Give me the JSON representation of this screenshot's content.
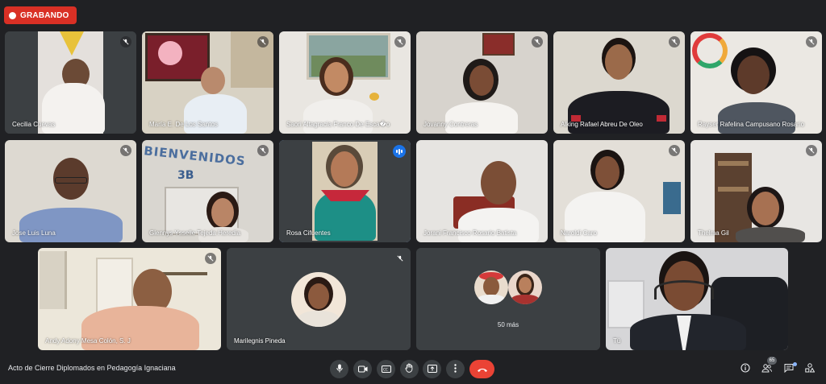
{
  "recording": {
    "label": "GRABANDO"
  },
  "participants": [
    {
      "name": "Cecilia Cuevas",
      "muted": true
    },
    {
      "name": "María E. De Los Santos",
      "muted": true
    },
    {
      "name": "Saori Altagracia Franco De Esca�o",
      "muted": true
    },
    {
      "name": "Jovanny Contreras",
      "muted": true
    },
    {
      "name": "Alking Rafael Abreu De Oleo",
      "muted": true
    },
    {
      "name": "Rayser Rafelina Campusano Rosario",
      "muted": true
    },
    {
      "name": "Jose Luis Luna",
      "muted": true
    },
    {
      "name": "Glennys Ysselle Tejeda Heredia",
      "muted": true
    },
    {
      "name": "Rosa Cifuentes",
      "muted": false,
      "speaking": true
    },
    {
      "name": "Jorani Francisco Rosario Batista",
      "muted": false
    },
    {
      "name": "Naroldi Caro",
      "muted": true
    },
    {
      "name": "Thelma Gil",
      "muted": true
    },
    {
      "name": "Andy Adony Mesa Colón, S. J",
      "muted": true
    },
    {
      "name": "Marilegnis Pineda",
      "muted": true
    },
    {
      "name": "Tú",
      "muted": false
    }
  ],
  "wallsign": {
    "line1": "BIENVENIDOS",
    "line2": "3B"
  },
  "overflow": {
    "label": "50 más"
  },
  "meeting": {
    "title": "Acto de Cierre Diplomados en Pedagogía Ignaciana"
  },
  "controls": [
    "microphone-icon",
    "camera-icon",
    "captions-icon",
    "raise-hand-icon",
    "present-icon",
    "more-options-icon",
    "end-call-icon"
  ],
  "right_controls": {
    "info": "info-icon",
    "people": "people-icon",
    "people_count": "65",
    "chat": "chat-icon",
    "activities": "activities-icon"
  },
  "colors": {
    "background": "#202124",
    "tile": "#3c4043",
    "recording": "#d93025",
    "end_call": "#ea4335",
    "active_outline": "#8ab4f8",
    "speaking": "#1a73e8"
  }
}
